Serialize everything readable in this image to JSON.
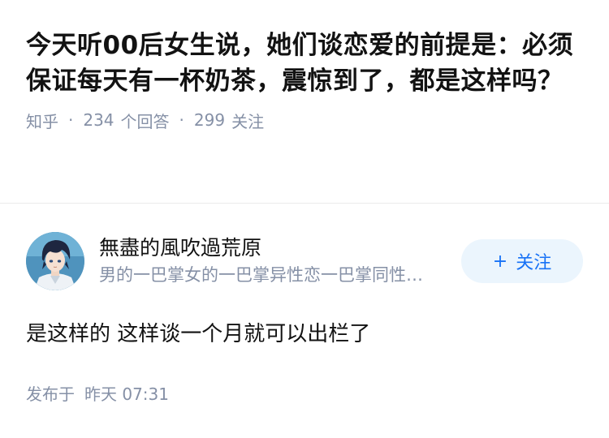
{
  "question": {
    "title": "今天听00后女生说，她们谈恋爱的前提是：必须保证每天有一杯奶茶，震惊到了，都是这样吗？",
    "source": "知乎",
    "separator": "·",
    "answer_count": "234",
    "answer_label": "个回答",
    "follow_count": "299",
    "follow_label": "关注"
  },
  "answer": {
    "author_name": "無盡的風吹過荒原",
    "author_bio": "男的一巴掌女的一巴掌异性恋一巴掌同性恋一巴掌",
    "follow_button": {
      "icon": "plus-icon",
      "plus": "+",
      "label": "关注"
    },
    "content": "是这样的 这样谈一个月就可以出栏了",
    "published_label": "发布于",
    "published_time": "昨天 07:31"
  },
  "colors": {
    "meta_gray": "#8590a6",
    "accent_blue": "#1772f6",
    "follow_bg": "#ebf5fd",
    "text": "#121212",
    "divider": "#ebebeb"
  }
}
